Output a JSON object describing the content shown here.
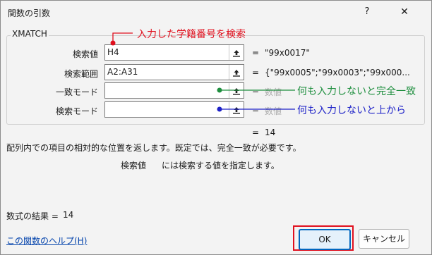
{
  "titlebar": {
    "title": "関数の引数",
    "help": "?",
    "close": "✕"
  },
  "function_name": "XMATCH",
  "args": [
    {
      "label": "検索値",
      "value": "H4",
      "result": "\"99x0017\""
    },
    {
      "label": "検索範囲",
      "value": "A2:A31",
      "result": "{\"99x0005\";\"99x0003\";\"99x000..."
    },
    {
      "label": "一致モード",
      "value": "",
      "result": "数値"
    },
    {
      "label": "検索モード",
      "value": "",
      "result": "数値"
    }
  ],
  "equals": "=",
  "total_result": "14",
  "description": "配列内での項目の相対的な位置を返します。既定では、完全一致が必要です。",
  "arg_help": {
    "name": "検索値",
    "text": "には検索する値を指定します。"
  },
  "formula": {
    "label": "数式の結果 =",
    "value": "14"
  },
  "help_link": "この関数のヘルプ(H)",
  "buttons": {
    "ok": "OK",
    "cancel": "キャンセル"
  },
  "annotations": {
    "red": "入力した学籍番号を検索",
    "green": "何も入力しないと完全一致",
    "blue": "何も入力しないと上から"
  },
  "colors": {
    "red": "#e0101e",
    "green": "#1f8f3f",
    "blue": "#1e22c8",
    "link": "#0645ad"
  }
}
